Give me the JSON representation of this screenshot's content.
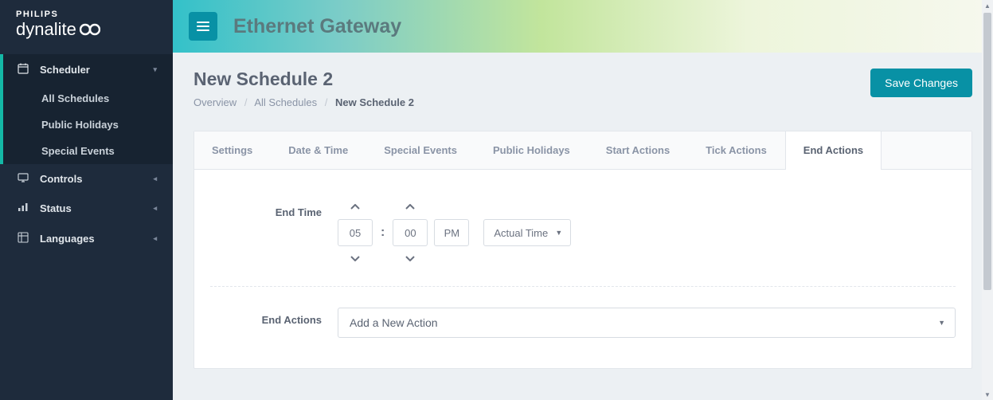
{
  "brand": {
    "company": "PHILIPS",
    "product": "dynalite"
  },
  "sidebar": {
    "items": [
      {
        "label": "Scheduler",
        "expanded": true
      },
      {
        "label": "Controls",
        "expanded": false
      },
      {
        "label": "Status",
        "expanded": false
      },
      {
        "label": "Languages",
        "expanded": false
      }
    ],
    "scheduler_sub": [
      {
        "label": "All Schedules"
      },
      {
        "label": "Public Holidays"
      },
      {
        "label": "Special Events"
      }
    ]
  },
  "topbar": {
    "title": "Ethernet Gateway"
  },
  "page": {
    "title": "New Schedule 2",
    "breadcrumb": {
      "root": "Overview",
      "mid": "All Schedules",
      "current": "New Schedule 2"
    },
    "save_label": "Save Changes"
  },
  "tabs": [
    {
      "label": "Settings"
    },
    {
      "label": "Date & Time"
    },
    {
      "label": "Special Events"
    },
    {
      "label": "Public Holidays"
    },
    {
      "label": "Start Actions"
    },
    {
      "label": "Tick Actions"
    },
    {
      "label": "End Actions"
    }
  ],
  "form": {
    "end_time_label": "End Time",
    "hour": "05",
    "minute": "00",
    "ampm": "PM",
    "time_mode": "Actual Time",
    "end_actions_label": "End Actions",
    "add_action_label": "Add a New Action"
  }
}
